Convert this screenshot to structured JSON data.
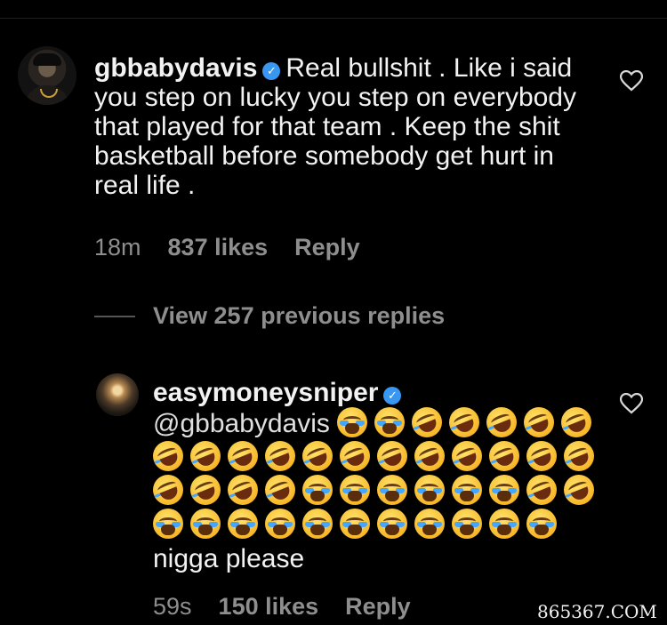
{
  "comment": {
    "username": "gbbabydavis",
    "text": "Real bullshit . Like i said you step on lucky you step on everybody  that played for that team . Keep the shit basketball before somebody get hurt in real life .",
    "time": "18m",
    "likes": "837 likes",
    "reply_label": "Reply"
  },
  "thread": {
    "view_replies_label": "View 257 previous replies"
  },
  "reply": {
    "username": "easymoneysniper",
    "mention": "@gbbabydavis",
    "emojis": [
      "crying",
      "crying",
      "laughing",
      "laughing",
      "laughing",
      "laughing",
      "laughing",
      "laughing",
      "laughing",
      "laughing",
      "laughing",
      "laughing",
      "laughing",
      "laughing",
      "laughing",
      "laughing",
      "laughing",
      "laughing",
      "laughing",
      "laughing",
      "laughing",
      "laughing",
      "laughing",
      "crying",
      "crying",
      "crying",
      "crying",
      "crying",
      "crying",
      "laughing",
      "laughing",
      "crying",
      "crying",
      "crying",
      "crying",
      "crying",
      "crying",
      "crying",
      "crying",
      "crying",
      "crying",
      "crying"
    ],
    "text_tail": "nigga please",
    "time": "59s",
    "likes": "150 likes",
    "reply_label": "Reply"
  },
  "icons": {
    "verified": "verified-badge-icon",
    "heart": "heart-outline-icon",
    "verified_color": "#3897f0"
  },
  "watermark": "865367.COM"
}
